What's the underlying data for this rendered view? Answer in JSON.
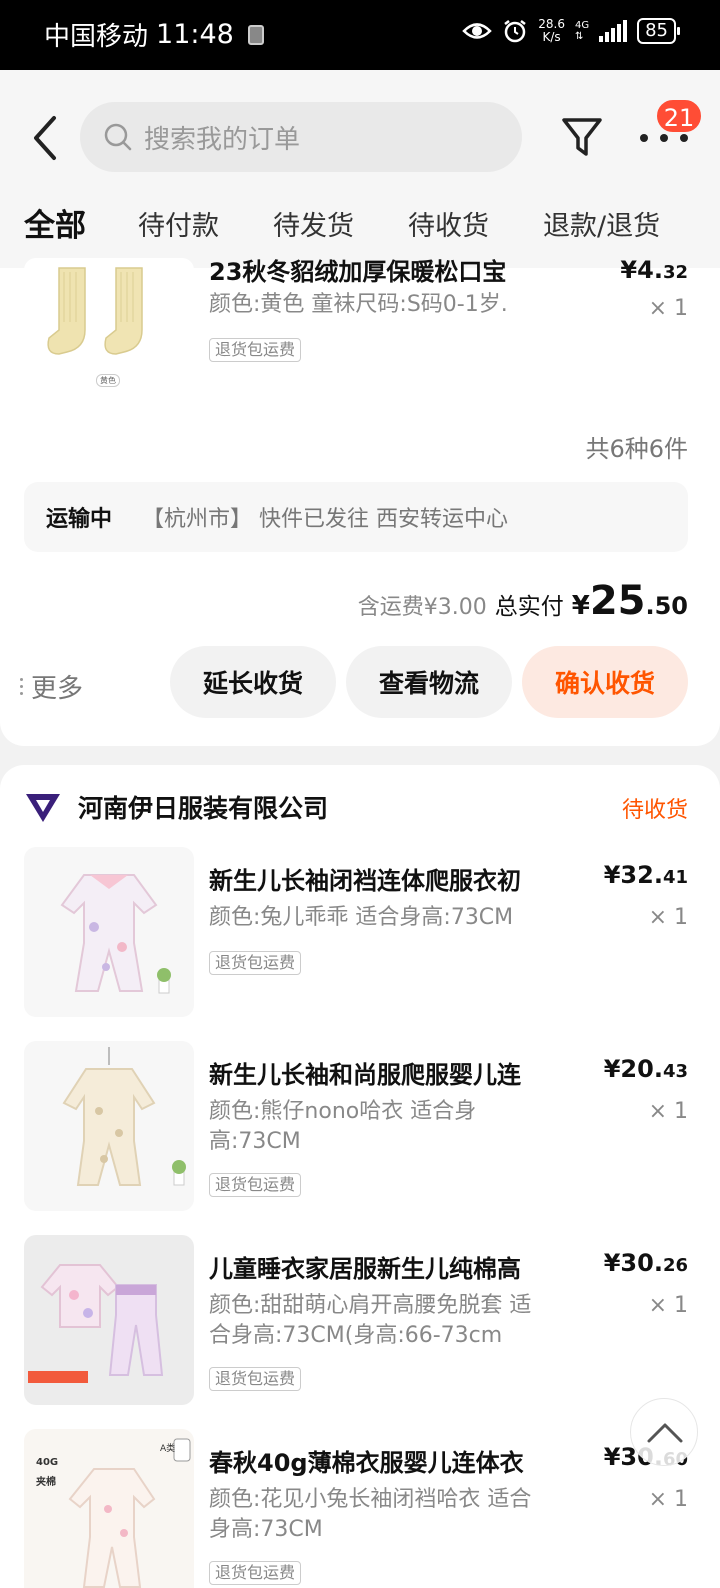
{
  "status_bar": {
    "carrier": "中国移动",
    "time": "11:48",
    "speed_value": "28.6",
    "speed_unit": "K/s",
    "network": "4G",
    "battery": "85"
  },
  "header": {
    "search_placeholder": "搜索我的订单",
    "badge_count": "21"
  },
  "tabs": [
    "全部",
    "待付款",
    "待发货",
    "待收货",
    "退款/退货"
  ],
  "order1": {
    "partial_item": {
      "title": "23秋冬貂绒加厚保暖松口宝",
      "spec": "颜色:黄色 童袜尺码:S码0-1岁.",
      "tag": "退货包运费",
      "price_int": "¥4.",
      "price_dec": "32",
      "qty": "× 1",
      "thumb_label": "黄色"
    },
    "count_text": "共6种6件",
    "logistics": {
      "status": "运输中",
      "text": "【杭州市】 快件已发往 西安转运中心"
    },
    "total": {
      "shipping": "含运费¥3.00",
      "label": "总实付",
      "currency": "¥",
      "int": "25",
      "dec": ".50"
    },
    "more_label": "更多",
    "buttons": {
      "extend": "延长收货",
      "track": "查看物流",
      "confirm": "确认收货"
    }
  },
  "order2": {
    "shop_name": "河南伊日服装有限公司",
    "status": "待收货",
    "items": [
      {
        "title": "新生儿长袖闭裆连体爬服衣初",
        "spec": "颜色:兔儿乖乖 适合身高:73CM",
        "tag": "退货包运费",
        "price_int": "¥32.",
        "price_dec": "41",
        "qty": "× 1"
      },
      {
        "title": "新生儿长袖和尚服爬服婴儿连",
        "spec": "颜色:熊仔nono哈衣 适合身高:73CM",
        "tag": "退货包运费",
        "price_int": "¥20.",
        "price_dec": "43",
        "qty": "× 1"
      },
      {
        "title": "儿童睡衣家居服新生儿纯棉高",
        "spec": "颜色:甜甜萌心肩开高腰免脱套 适合身高:73CM(身高:66-73cm",
        "tag": "退货包运费",
        "price_int": "¥30.",
        "price_dec": "26",
        "qty": "× 1"
      },
      {
        "title": "春秋40g薄棉衣服婴儿连体衣",
        "spec": "颜色:花见小兔长袖闭裆哈衣 适合身高:73CM",
        "tag": "退货包运费",
        "price_int": "¥30.",
        "price_dec": "60",
        "qty": "× 1"
      }
    ]
  },
  "thumb_badges": {
    "cotton_weight": "40G",
    "cotton_label": "夹棉",
    "grade": "A类"
  },
  "colors": {
    "accent": "#ff5500",
    "badge": "#ff4d35",
    "confirm_bg": "#fde9e1"
  }
}
